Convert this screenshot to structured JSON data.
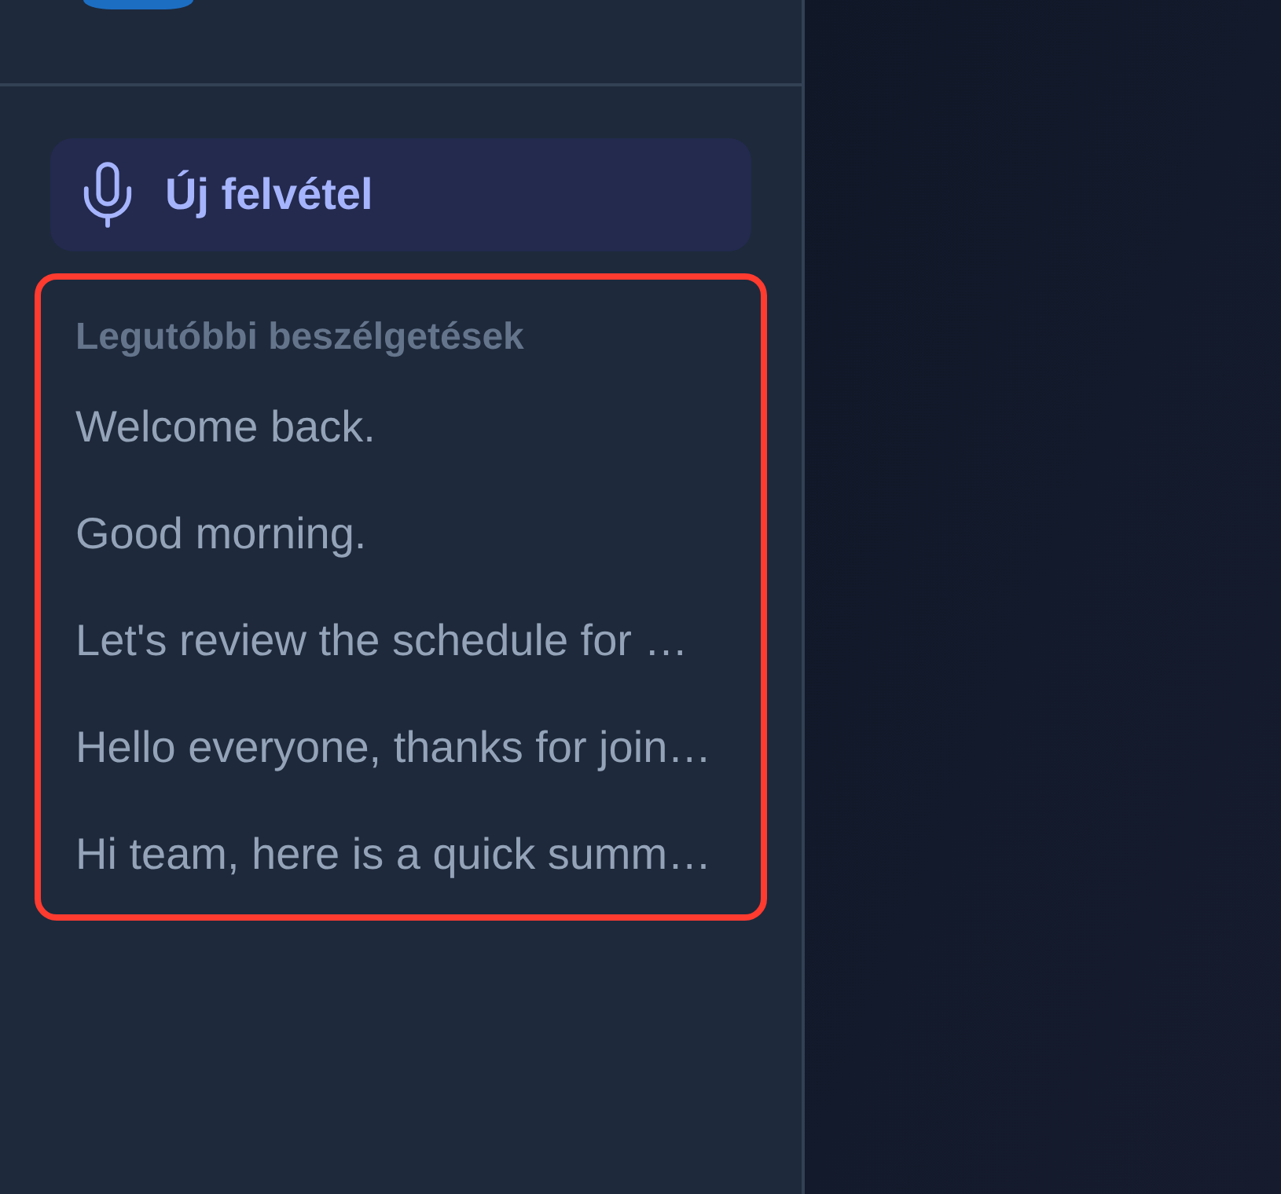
{
  "sidebar": {
    "new_recording_button": {
      "label": "Új felvétel"
    },
    "recent": {
      "highlighted": true,
      "heading": "Legutóbbi beszélgetések",
      "items": [
        {
          "title": "Welcome back."
        },
        {
          "title": "Good morning."
        },
        {
          "title": "Let's review the schedule for …"
        },
        {
          "title": "Hello everyone, thanks for join…"
        },
        {
          "title": "Hi team, here is a quick summ…"
        }
      ]
    }
  }
}
